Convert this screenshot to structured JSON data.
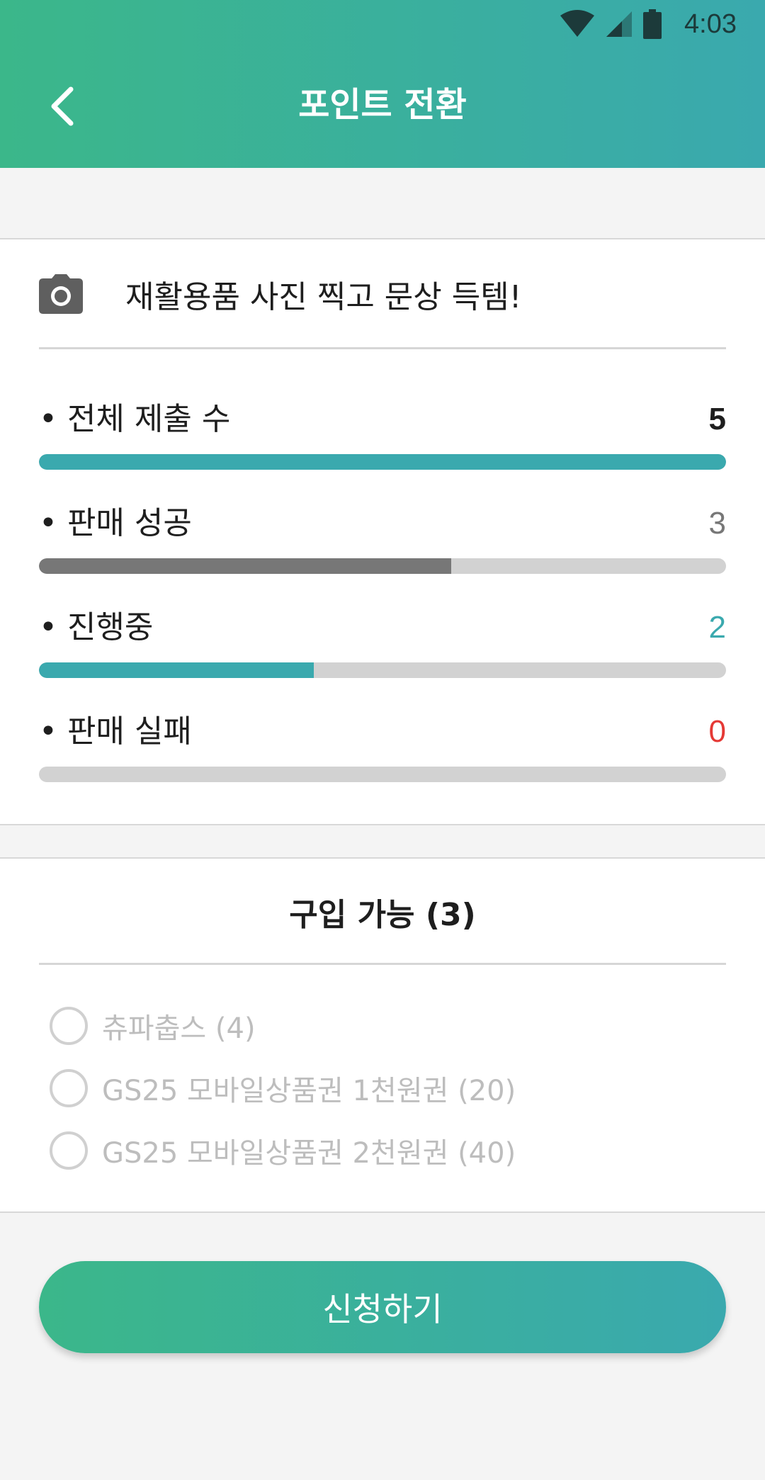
{
  "status_bar": {
    "time": "4:03",
    "icons": [
      "wifi-icon",
      "cell-signal-icon",
      "battery-icon"
    ]
  },
  "header": {
    "title": "포인트 전환",
    "back_icon": "chevron-left-icon"
  },
  "promo": {
    "icon": "camera-icon",
    "text": "재활용품 사진 찍고 문상 득템!"
  },
  "stats": [
    {
      "label": "• 전체 제출 수",
      "value": "5",
      "fraction": 1.0,
      "value_color": "#1e1e1e",
      "bar_color": "#3aa9ae"
    },
    {
      "label": "• 판매 성공",
      "value": "3",
      "fraction": 0.6,
      "value_color": "#777777",
      "bar_color": "#777777"
    },
    {
      "label": "• 진행중",
      "value": "2",
      "fraction": 0.4,
      "value_color": "#3aa9ae",
      "bar_color": "#3aa9ae"
    },
    {
      "label": "• 판매 실패",
      "value": "0",
      "fraction": 0.0,
      "value_color": "#e53935",
      "bar_color": "#e53935"
    }
  ],
  "purchase": {
    "title": "구입 가능 (3)",
    "options": [
      {
        "label": "츄파춥스 (4)"
      },
      {
        "label": "GS25 모바일상품권 1천원권 (20)"
      },
      {
        "label": "GS25 모바일상품권 2천원권 (40)"
      }
    ]
  },
  "apply_button": {
    "label": "신청하기"
  },
  "colors": {
    "gradient_start": "#3bb78a",
    "gradient_end": "#3aa9ae"
  }
}
